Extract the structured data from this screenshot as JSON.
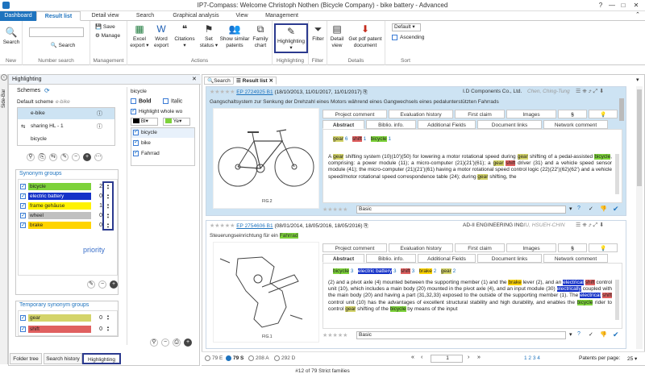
{
  "window": {
    "title": "IP7-Compass: Welcome Christoph Nothen (Bicycle Company) - bike battery - Advanced",
    "help": "?",
    "minimize": "—",
    "restore": "□",
    "close": "✕"
  },
  "tabs": [
    "Dashboard",
    "Result list",
    "Detail view",
    "Search",
    "Graphical analysis",
    "View",
    "Management"
  ],
  "ribbon": {
    "new": {
      "search": "Search",
      "group": "New"
    },
    "number_search": {
      "search": "Search",
      "group": "Number search"
    },
    "management": {
      "save": "Save",
      "manage": "Manage",
      "group": "Management"
    },
    "actions": {
      "excel": "Excel",
      "excel2": "export ▾",
      "word": "Word",
      "word2": "export",
      "citations": "Citations",
      "citations2": "▾",
      "set": "Set",
      "set2": "status ▾",
      "similar": "Show similar",
      "similar2": "patents",
      "family": "Family",
      "family2": "chart",
      "group": "Actions"
    },
    "highlighting": {
      "label": "Highlighting",
      "arrow": "▾",
      "group": "Highlighting"
    },
    "filter": {
      "label": "Filter",
      "group": "Filter"
    },
    "details": {
      "detail": "Detail",
      "detail2": "view",
      "pdf": "Get pdf patent",
      "pdf2": "document",
      "group": "Details"
    },
    "sort": {
      "default": "Default",
      "ascending": "Ascending",
      "group": "Sort"
    }
  },
  "sidebar": {
    "label": "Side-Bar"
  },
  "left_panel": {
    "title": "Highlighting",
    "schemes": {
      "title": "Schemes",
      "default_label": "Default scheme",
      "default_value": "e-bike",
      "items": [
        "e-bike",
        "sharing HL - 1",
        "bicycle"
      ]
    },
    "synonym_groups": {
      "title": "Synonym groups",
      "items": [
        {
          "label": "bicycle",
          "color": "#7dd23a",
          "priority": "2"
        },
        {
          "label": "electric battery",
          "color": "#1532c8",
          "priority": "0"
        },
        {
          "label": "frame gehäuse",
          "color": "#fff200",
          "priority": "1"
        },
        {
          "label": "wheel",
          "color": "#c0c0c0",
          "priority": "0"
        },
        {
          "label": "brake",
          "color": "#ffd400",
          "priority": "0"
        }
      ],
      "priority_label": "priority"
    },
    "temp_groups": {
      "title": "Temporary synonym groups",
      "items": [
        {
          "label": "gear",
          "color": "#d4d46a",
          "priority": "0"
        },
        {
          "label": "shift",
          "color": "#e06060",
          "priority": "0"
        }
      ]
    },
    "word_panel": {
      "title": "bicycle",
      "bold": "Bold",
      "italic": "Italic",
      "highlight_whole": "Highlight whole wo",
      "color1": "Bl",
      "color2": "Ye",
      "words": [
        "bicycle",
        "bike",
        "Fahrrad"
      ]
    },
    "bottom_tabs": [
      "Folder tree",
      "Search history",
      "Highlighting"
    ]
  },
  "doc_tabs": [
    "Search",
    "Result list"
  ],
  "results": [
    {
      "stars": "★★★★★",
      "number": "EP 2724925 B1",
      "dates": "(18/10/2013, 11/01/2017, 11/01/2017)",
      "company": "I.D Components Co., Ltd.",
      "inventor": "Chen, Ching-Tung",
      "title": "Gangschaltsystem zur Senkung der Drehzahl eines Motors während eines Gangwechsels eines pedalunterstützten Fahrrads",
      "tabs_top": [
        "Project comment",
        "Evaluation history",
        "First claim",
        "Images",
        "§",
        "💡"
      ],
      "tabs_bottom": [
        "Abstract",
        "Biblio. info.",
        "Additional Fields",
        "Document links",
        "Network comment"
      ],
      "keywords": [
        {
          "w": "gear",
          "c": "6"
        },
        {
          "w": "shift",
          "c": "1"
        },
        {
          "w": "bicycle",
          "c": "1"
        }
      ],
      "abstract": [
        "A ",
        "gear",
        " shifting system (10)(10')(50) for lowering a motor rotational speed during ",
        "gear",
        " shifting of a pedal-assisted ",
        "bicycle",
        ", comprising: a power module (11); a micro-computer (21)(21')(61); a ",
        "gear",
        " ",
        "shift",
        " driver (31) and a vehicle speed sensor module (41); the micro-computer (21)(21')(61) having a motor rotational speed control logic (22)(22')(62)(62') and a vehicle speed/motor rotational speed correspondence table (24); during ",
        "gear",
        " shifting, the"
      ],
      "comment": "Basic",
      "fig": "FIG.2"
    },
    {
      "stars": "★★★★★",
      "number": "EP 2754606 B1",
      "dates": "(08/01/2014, 18/05/2016, 18/05/2016)",
      "company": "AD-II ENGINEERING INC.",
      "inventor": "MU, HSUEH-CHIN",
      "title_pre": "Steuerungseinrichtung für ein ",
      "title_hl": "Fahrrad",
      "tabs_top": [
        "Project comment",
        "Evaluation history",
        "First claim",
        "Images",
        "§",
        "💡"
      ],
      "tabs_bottom": [
        "Abstract",
        "Biblio. info.",
        "Additional Fields",
        "Document links",
        "Network comment"
      ],
      "keywords": [
        {
          "w": "bicycle",
          "c": "3"
        },
        {
          "w": "electric battery",
          "c": "3"
        },
        {
          "w": "shift",
          "c": "3"
        },
        {
          "w": "brake",
          "c": "2"
        },
        {
          "w": "gear",
          "c": "2"
        }
      ],
      "abstract": [
        "(2) and a pivot axle (4) mounted between the supporting member (1) and the ",
        "brake",
        " lever (2), and an ",
        "electrical",
        " ",
        "shift",
        " control unit (10), which includes a main body (20) mounted in the pivot axle (4), and an input module (30) ",
        "electrically",
        " coupled with the main body (20) and having a part (31,32,33) exposed to the outside of the supporting member (1). The ",
        "electrical",
        " ",
        "shift",
        " control unit (10) has the advantages of excellent structural stability and high durability, and enables the ",
        "bicycle",
        " rider to control ",
        "gear",
        " shifting of the ",
        "bicycle",
        " by means of the input"
      ],
      "comment": "Basic",
      "fig": "FIG.1"
    }
  ],
  "statusbar": {
    "counts": [
      "79 E",
      "79 S",
      "208 A",
      "292 D"
    ],
    "page": "1",
    "pages": "1 2 3 4",
    "per_page_label": "Patents per page:",
    "per_page": "25"
  },
  "footer": "#12 of 79 Strict families"
}
